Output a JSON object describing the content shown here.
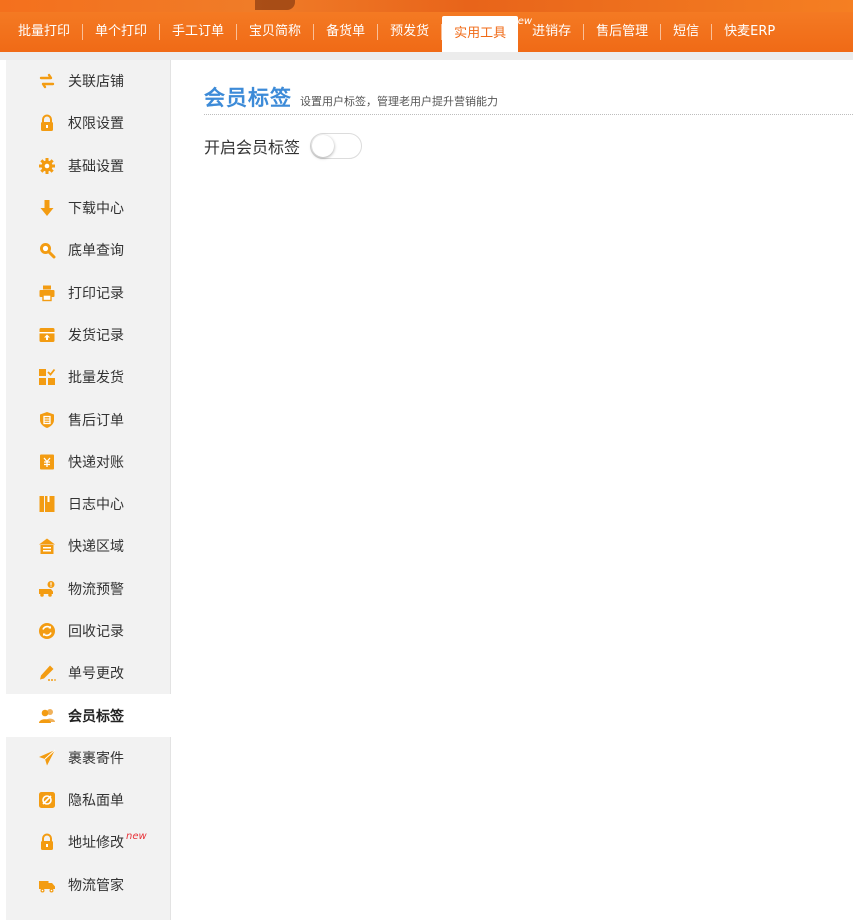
{
  "colors": {
    "accent": "#f06a16",
    "title_blue": "#3d8bd8",
    "icon_orange": "#f39c12",
    "badge_red": "#e8343a"
  },
  "nav": {
    "items": [
      {
        "label": "批量打印"
      },
      {
        "label": "单个打印"
      },
      {
        "label": "手工订单"
      },
      {
        "label": "宝贝简称"
      },
      {
        "label": "备货单"
      },
      {
        "label": "预发货"
      },
      {
        "label": "实用工具",
        "active": true,
        "badge": "new"
      },
      {
        "label": "进销存"
      },
      {
        "label": "售后管理"
      },
      {
        "label": "短信"
      },
      {
        "label": "快麦ERP"
      }
    ]
  },
  "sidebar": {
    "items": [
      {
        "label": "关联店铺",
        "icon": "link-arrows-icon"
      },
      {
        "label": "权限设置",
        "icon": "lock-icon"
      },
      {
        "label": "基础设置",
        "icon": "gear-icon"
      },
      {
        "label": "下载中心",
        "icon": "download-arrow-icon"
      },
      {
        "label": "底单查询",
        "icon": "search-icon"
      },
      {
        "label": "打印记录",
        "icon": "printer-icon"
      },
      {
        "label": "发货记录",
        "icon": "shipping-box-icon"
      },
      {
        "label": "批量发货",
        "icon": "grid-check-icon"
      },
      {
        "label": "售后订单",
        "icon": "after-sale-shield-icon"
      },
      {
        "label": "快递对账",
        "icon": "bill-icon"
      },
      {
        "label": "日志中心",
        "icon": "log-book-icon"
      },
      {
        "label": "快递区域",
        "icon": "warehouse-icon"
      },
      {
        "label": "物流预警",
        "icon": "truck-alert-icon"
      },
      {
        "label": "回收记录",
        "icon": "recycle-icon"
      },
      {
        "label": "单号更改",
        "icon": "pen-edit-icon"
      },
      {
        "label": "会员标签",
        "icon": "members-icon",
        "active": true
      },
      {
        "label": "裹裹寄件",
        "icon": "paper-plane-icon"
      },
      {
        "label": "隐私面单",
        "icon": "privacy-icon"
      },
      {
        "label": "地址修改",
        "icon": "lock-icon",
        "badge": "new"
      },
      {
        "label": "物流管家",
        "icon": "truck-icon"
      }
    ]
  },
  "main": {
    "title": "会员标签",
    "description": "设置用户标签，管理老用户提升营销能力",
    "toggle_label": "开启会员标签",
    "toggle_on": false
  }
}
